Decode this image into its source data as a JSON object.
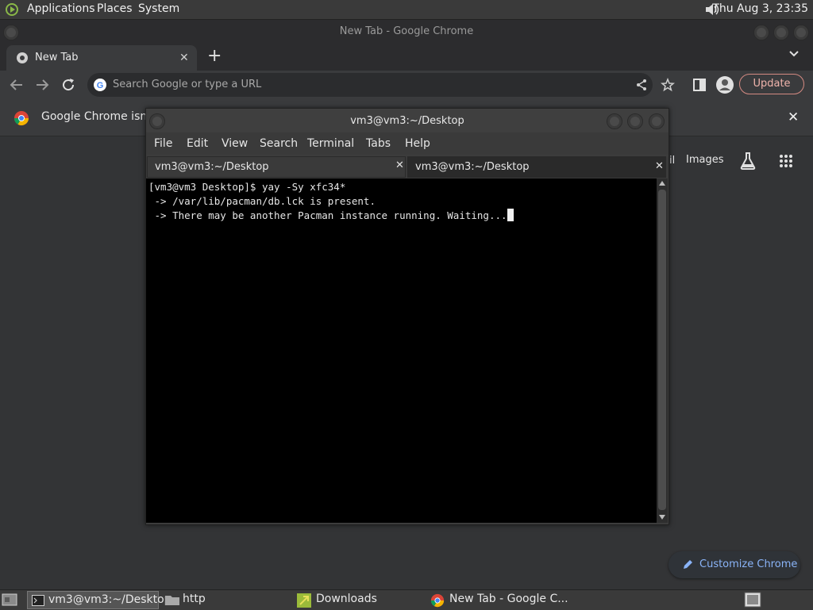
{
  "top_panel": {
    "menus": [
      "Applications",
      "Places",
      "System"
    ],
    "clock": "Thu Aug  3, 23:35"
  },
  "chrome": {
    "window_title": "New Tab - Google Chrome",
    "tab_label": "New Tab",
    "omnibox_placeholder": "Search Google or type a URL",
    "update_label": "Update",
    "infobar_text": "Google Chrome isn't y",
    "ntp_links": {
      "gmail_fragment": "il",
      "images": "Images"
    },
    "customize_label": "Customize Chrome"
  },
  "terminal": {
    "window_title": "vm3@vm3:~/Desktop",
    "menu": [
      "File",
      "Edit",
      "View",
      "Search",
      "Terminal",
      "Tabs",
      "Help"
    ],
    "tabs": [
      "vm3@vm3:~/Desktop",
      "vm3@vm3:~/Desktop"
    ],
    "lines": [
      "[vm3@vm3 Desktop]$ yay -Sy xfc34*",
      " -> /var/lib/pacman/db.lck is present.",
      " -> There may be another Pacman instance running. Waiting..."
    ]
  },
  "taskbar": {
    "items": [
      "vm3@vm3:~/Desktop",
      "http",
      "Downloads",
      "New Tab - Google C..."
    ]
  }
}
